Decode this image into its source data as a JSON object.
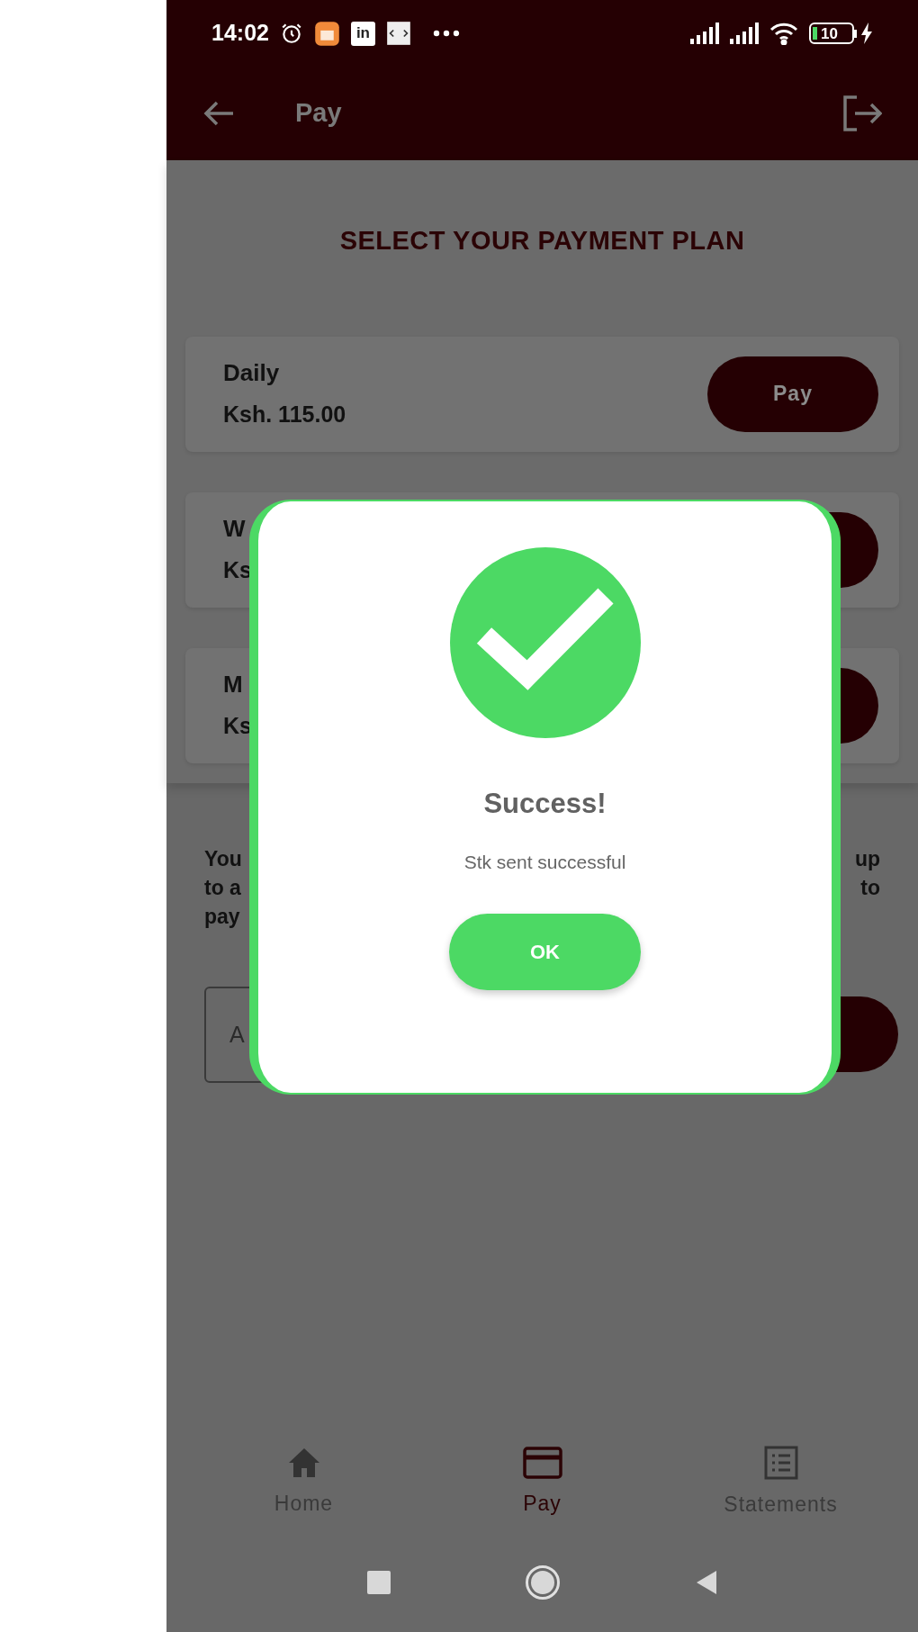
{
  "status_bar": {
    "time": "14:02",
    "notification_badge": "in",
    "battery": "10"
  },
  "app_bar": {
    "title": "Pay"
  },
  "heading": "SELECT YOUR PAYMENT PLAN",
  "plans": [
    {
      "name": "Daily",
      "price": "Ksh. 115.00",
      "button": "Pay"
    },
    {
      "name": "W",
      "price": "Ks"
    },
    {
      "name": "M",
      "price": "Ks"
    }
  ],
  "note": {
    "left_lines": [
      "You",
      "to a",
      "pay"
    ],
    "right_lines": [
      "up",
      "to"
    ]
  },
  "amount_field": {
    "placeholder": "A"
  },
  "dialog": {
    "title": "Success!",
    "message": "Stk sent successful",
    "button": "OK"
  },
  "bottom_nav": [
    {
      "kind": "home",
      "label": "Home",
      "selected": false
    },
    {
      "kind": "card",
      "label": "Pay",
      "selected": true
    },
    {
      "kind": "list",
      "label": "Statements",
      "selected": false
    }
  ]
}
